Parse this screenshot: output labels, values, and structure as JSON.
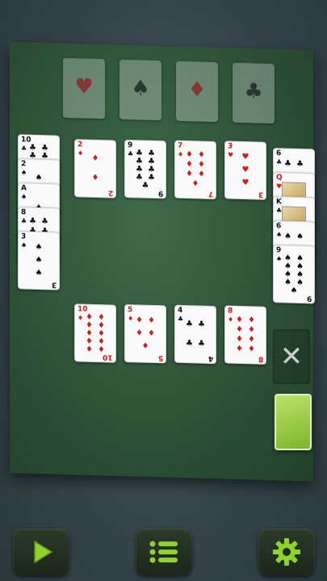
{
  "accent_color": "#8fd12e",
  "foundations": [
    {
      "suit": "hearts",
      "symbol": "♥",
      "color": "red"
    },
    {
      "suit": "spades",
      "symbol": "♠",
      "color": "black"
    },
    {
      "suit": "diamonds",
      "symbol": "♦",
      "color": "red"
    },
    {
      "suit": "clubs",
      "symbol": "♣",
      "color": "black"
    }
  ],
  "left_column": [
    {
      "rank": "10",
      "symbol": "♣",
      "color": "black"
    },
    {
      "rank": "2",
      "symbol": "♠",
      "color": "black"
    },
    {
      "rank": "A",
      "symbol": "♠",
      "color": "black"
    },
    {
      "rank": "8",
      "symbol": "♣",
      "color": "black"
    },
    {
      "rank": "3",
      "symbol": "♠",
      "color": "black"
    }
  ],
  "right_column": [
    {
      "rank": "6",
      "symbol": "♣",
      "color": "black"
    },
    {
      "rank": "Q",
      "symbol": "♥",
      "color": "red"
    },
    {
      "rank": "K",
      "symbol": "♣",
      "color": "black"
    },
    {
      "rank": "6",
      "symbol": "♠",
      "color": "black"
    },
    {
      "rank": "9",
      "symbol": "♠",
      "color": "black"
    }
  ],
  "top_row": [
    {
      "rank": "2",
      "symbol": "♦",
      "color": "red"
    },
    {
      "rank": "9",
      "symbol": "♣",
      "color": "black"
    },
    {
      "rank": "7",
      "symbol": "♦",
      "color": "red"
    },
    {
      "rank": "3",
      "symbol": "♥",
      "color": "red"
    }
  ],
  "bottom_row": [
    {
      "rank": "10",
      "symbol": "♦",
      "color": "red"
    },
    {
      "rank": "5",
      "symbol": "♦",
      "color": "red"
    },
    {
      "rank": "4",
      "symbol": "♣",
      "color": "black"
    },
    {
      "rank": "8",
      "symbol": "♦",
      "color": "red"
    }
  ],
  "waste": {
    "icon": "close-icon",
    "glyph": "✕"
  },
  "stock": {
    "icon": "card-back"
  },
  "buttons": [
    {
      "name": "play-button",
      "icon": "play-icon"
    },
    {
      "name": "menu-button",
      "icon": "list-icon"
    },
    {
      "name": "settings-button",
      "icon": "gear-icon"
    }
  ]
}
